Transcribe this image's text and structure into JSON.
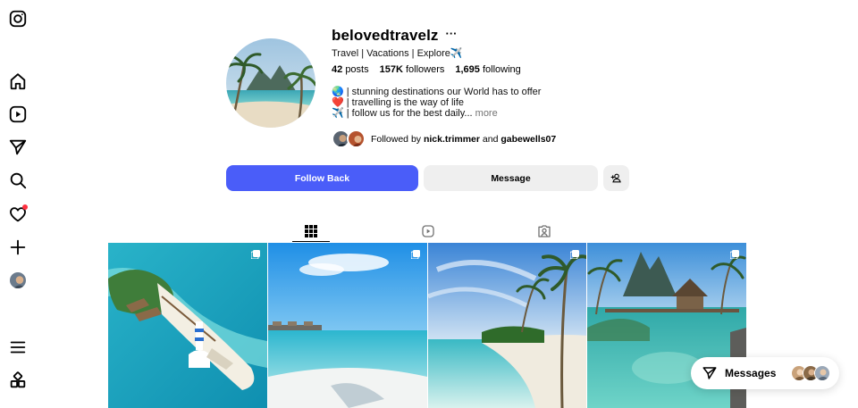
{
  "sidebar": {
    "items": [
      {
        "name": "instagram-logo-icon"
      },
      {
        "name": "home-icon"
      },
      {
        "name": "reels-icon"
      },
      {
        "name": "explore-icon"
      },
      {
        "name": "search-icon"
      },
      {
        "name": "notifications-heart-icon",
        "badge": true
      },
      {
        "name": "create-plus-icon"
      },
      {
        "name": "profile-avatar"
      },
      {
        "name": "menu-icon"
      },
      {
        "name": "also-from-meta-icon"
      }
    ]
  },
  "profile": {
    "username": "belovedtravelz",
    "more_icon": "···",
    "tagline": "Travel | Vacations | Explore✈️",
    "stats": {
      "posts_count": "42",
      "posts_label": "posts",
      "followers_count": "157K",
      "followers_label": "followers",
      "following_count": "1,695",
      "following_label": "following"
    },
    "bio": [
      "🌏 | stunning destinations our World has to offer",
      "❤️ | travelling is the way of life",
      "✈️ | follow us for the best daily..."
    ],
    "bio_more": "more",
    "followed_by": {
      "prefix": "Followed by",
      "user1": "nick.trimmer",
      "conj": "and",
      "user2": "gabewells07"
    }
  },
  "actions": {
    "follow_back": "Follow Back",
    "message": "Message",
    "add_user_icon": "person-add-icon"
  },
  "tabs": [
    {
      "name": "posts-grid-icon",
      "active": true
    },
    {
      "name": "reels-icon",
      "active": false
    },
    {
      "name": "tagged-icon",
      "active": false
    }
  ],
  "posts": [
    {
      "subject": "maldives-island-lighthouse",
      "multi": true
    },
    {
      "subject": "turquoise-sea-overwater-villas",
      "multi": true
    },
    {
      "subject": "palm-beach-clear-water",
      "multi": true
    },
    {
      "subject": "bora-bora-overwater-bungalow",
      "multi": true
    }
  ],
  "messages": {
    "label": "Messages"
  },
  "colors": {
    "accent": "#4a5df9",
    "button_grey": "#efefef",
    "notification": "#ff3040"
  }
}
